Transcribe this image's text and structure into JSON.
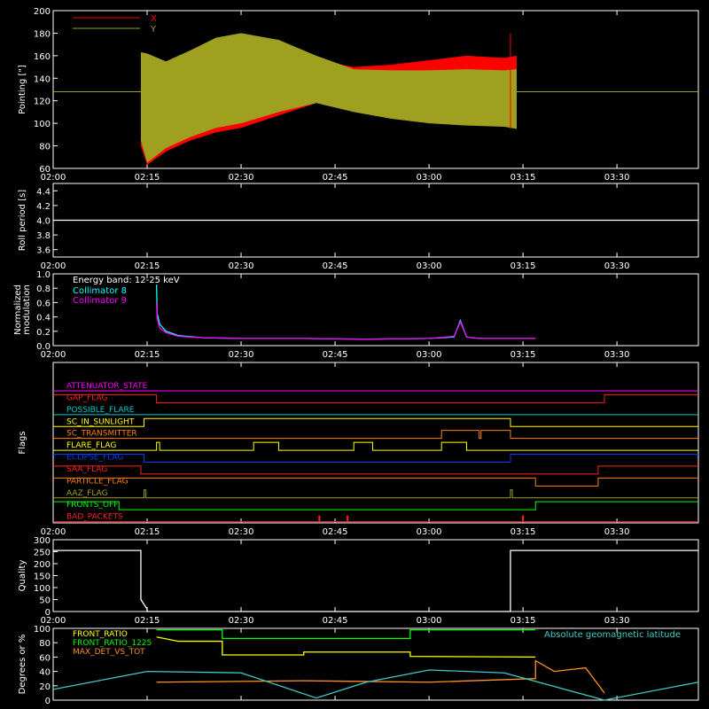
{
  "time_ticks": [
    "02:00",
    "02:15",
    "02:30",
    "02:45",
    "03:00",
    "03:15",
    "03:30"
  ],
  "chart_data": [
    {
      "type": "area",
      "ylabel": "Pointing [\"]",
      "ylim": [
        60,
        200
      ],
      "yticks": [
        "60",
        "80",
        "100",
        "120",
        "140",
        "160",
        "180",
        "200"
      ],
      "legend": [
        {
          "name": "X",
          "color": "#ff0000"
        },
        {
          "name": "Y",
          "color": "#a0a020"
        }
      ],
      "reference_line": 128,
      "x_range_minutes": [
        0,
        103
      ],
      "series": [
        {
          "name": "X",
          "color": "#ff0000",
          "x_minutes": [
            14,
            15,
            18,
            22,
            26,
            30,
            36,
            42,
            48,
            54,
            60,
            66,
            72,
            74
          ],
          "upper": [
            163,
            160,
            152,
            160,
            172,
            178,
            170,
            156,
            150,
            152,
            156,
            160,
            158,
            160
          ],
          "lower": [
            80,
            63,
            75,
            85,
            92,
            96,
            107,
            118,
            120,
            121,
            122,
            120,
            120,
            121
          ]
        },
        {
          "name": "Y",
          "color": "#a0a020",
          "x_minutes": [
            14,
            15,
            18,
            22,
            26,
            30,
            36,
            42,
            48,
            54,
            60,
            66,
            72,
            74
          ],
          "upper": [
            163,
            162,
            155,
            165,
            176,
            180,
            174,
            160,
            148,
            147,
            147,
            148,
            147,
            148
          ],
          "lower": [
            85,
            65,
            78,
            88,
            96,
            100,
            110,
            118,
            110,
            104,
            100,
            98,
            97,
            95
          ]
        }
      ]
    },
    {
      "type": "line",
      "ylabel": "Roll period [s]",
      "ylim": [
        3.5,
        4.5
      ],
      "yticks": [
        "3.6",
        "3.8",
        "4.0",
        "4.2",
        "4.4"
      ],
      "series": [
        {
          "color": "#ffffff",
          "x_minutes": [
            0,
            103
          ],
          "y": [
            4.0,
            4.0
          ]
        }
      ]
    },
    {
      "type": "line",
      "ylabel": "Normalized modulation",
      "ylim": [
        0,
        1.0
      ],
      "yticks": [
        "0.0",
        "0.2",
        "0.4",
        "0.6",
        "0.8",
        "1.0"
      ],
      "legend_title": "Energy band: 12-25 keV",
      "series": [
        {
          "name": "Collimator 8",
          "color": "#00ffff",
          "x_minutes": [
            16.5,
            16.6,
            17,
            18,
            20,
            24,
            30,
            40,
            50,
            60,
            64,
            65,
            66,
            68,
            72,
            77
          ],
          "y": [
            0.85,
            0.45,
            0.3,
            0.2,
            0.14,
            0.11,
            0.1,
            0.1,
            0.09,
            0.1,
            0.12,
            0.35,
            0.12,
            0.1,
            0.1,
            0.1
          ]
        },
        {
          "name": "Collimator 9",
          "color": "#ff00ff",
          "x_minutes": [
            16.5,
            16.6,
            17,
            18,
            20,
            24,
            30,
            40,
            50,
            60,
            64,
            65,
            66,
            68,
            72,
            77
          ],
          "y": [
            0.6,
            0.38,
            0.25,
            0.18,
            0.13,
            0.11,
            0.1,
            0.1,
            0.09,
            0.1,
            0.13,
            0.33,
            0.12,
            0.1,
            0.1,
            0.1
          ]
        }
      ]
    },
    {
      "type": "line",
      "ylabel": "Flags",
      "flags": [
        {
          "name": "ATTENUATOR_STATE",
          "color": "#ff00ff",
          "steps": []
        },
        {
          "name": "GAP_FLAG",
          "color": "#ff2020",
          "steps": [
            [
              0,
              1
            ],
            [
              16.5,
              0
            ],
            [
              88,
              1
            ]
          ]
        },
        {
          "name": "POSSIBLE_FLARE",
          "color": "#00c8c8",
          "steps": []
        },
        {
          "name": "SC_IN_SUNLIGHT",
          "color": "#ffff00",
          "steps": [
            [
              0,
              0
            ],
            [
              14.5,
              1
            ],
            [
              73,
              0
            ]
          ]
        },
        {
          "name": "SC_TRANSMITTER",
          "color": "#ff8000",
          "steps": [
            [
              0,
              0
            ],
            [
              62,
              1
            ],
            [
              68,
              1
            ],
            [
              68,
              0
            ],
            [
              68.3,
              1
            ],
            [
              73,
              0
            ]
          ]
        },
        {
          "name": "FLARE_FLAG",
          "color": "#ffff00",
          "steps": [
            [
              0,
              0
            ],
            [
              16.5,
              1
            ],
            [
              17,
              0
            ],
            [
              32,
              1
            ],
            [
              36,
              0
            ],
            [
              48,
              1
            ],
            [
              51,
              0
            ],
            [
              62,
              1
            ],
            [
              66,
              0
            ]
          ]
        },
        {
          "name": "ECLIPSE_FLAG",
          "color": "#0040ff",
          "steps": [
            [
              0,
              1
            ],
            [
              14.5,
              0
            ],
            [
              73,
              1
            ]
          ]
        },
        {
          "name": "SAA_FLAG",
          "color": "#ff2020",
          "steps": [
            [
              0,
              1
            ],
            [
              14,
              0
            ],
            [
              87,
              1
            ]
          ]
        },
        {
          "name": "PARTICLE_FLAG",
          "color": "#ff8000",
          "steps": [
            [
              0,
              1
            ],
            [
              77,
              0
            ],
            [
              87,
              1
            ]
          ]
        },
        {
          "name": "AAZ_FLAG",
          "color": "#a0a020",
          "steps": [
            [
              0,
              0
            ],
            [
              14.5,
              1
            ],
            [
              14.8,
              0
            ],
            [
              73,
              1
            ],
            [
              73.3,
              0
            ]
          ]
        },
        {
          "name": "FRONTS_OFF",
          "color": "#00ff00",
          "steps": [
            [
              0,
              1
            ],
            [
              10.5,
              0
            ],
            [
              77,
              1
            ]
          ]
        },
        {
          "name": "BAD_PACKETS",
          "color": "#ff2020",
          "spikes": [
            42.5,
            47,
            75
          ]
        }
      ]
    },
    {
      "type": "line",
      "ylabel": "Quality",
      "ylim": [
        0,
        300
      ],
      "yticks": [
        "0",
        "50",
        "100",
        "150",
        "200",
        "250",
        "300"
      ],
      "series": [
        {
          "color": "#ffffff",
          "x_minutes": [
            0,
            14,
            14,
            15,
            15,
            73,
            73,
            103
          ],
          "y": [
            255,
            255,
            50,
            10,
            0,
            0,
            255,
            255
          ]
        }
      ]
    },
    {
      "type": "line",
      "ylabel": "Degrees or %",
      "ylim": [
        0,
        100
      ],
      "yticks": [
        "0",
        "20",
        "40",
        "60",
        "80",
        "100"
      ],
      "annotation": "Absolute geomagnetic latitude",
      "series": [
        {
          "name": "FRONT_RATIO",
          "color": "#ffff00",
          "x_minutes": [
            16.5,
            20,
            27,
            27,
            40,
            40,
            57,
            57,
            77
          ],
          "y": [
            88,
            82,
            82,
            63,
            63,
            67,
            67,
            61,
            60
          ]
        },
        {
          "name": "FRONT_RATIO_1225",
          "color": "#00ff00",
          "x_minutes": [
            16.5,
            27,
            27,
            57,
            57,
            77
          ],
          "y": [
            98,
            98,
            86,
            86,
            98,
            98
          ]
        },
        {
          "name": "MAX_DET_VS_TOT",
          "color": "#ff9020",
          "x_minutes": [
            16.5,
            40,
            60,
            77,
            77,
            80,
            85,
            88
          ],
          "y": [
            25,
            27,
            25,
            30,
            55,
            40,
            45,
            10
          ]
        },
        {
          "name": "Absolute geomagnetic latitude",
          "color": "#40c8c8",
          "x_minutes": [
            0,
            15,
            30,
            42,
            50,
            60,
            72,
            88,
            103
          ],
          "y": [
            15,
            40,
            38,
            3,
            25,
            42,
            38,
            0,
            25
          ]
        }
      ]
    }
  ]
}
